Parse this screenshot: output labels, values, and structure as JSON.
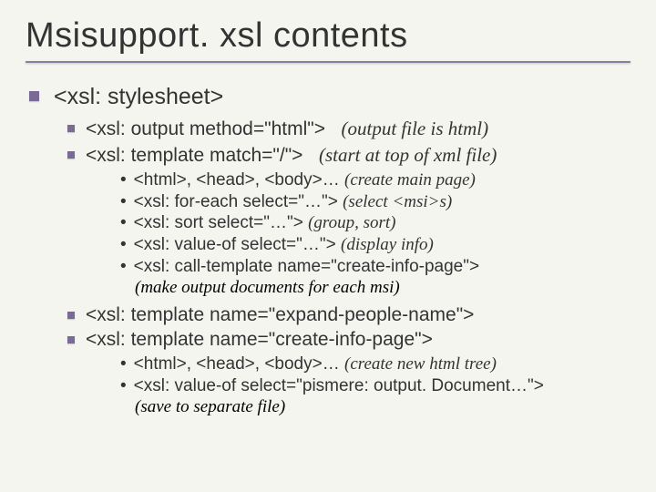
{
  "title": "Msisupport. xsl contents",
  "lvl1": {
    "text": "<xsl: stylesheet>"
  },
  "lvl2a": [
    {
      "code": "<xsl: output method=\"html\">",
      "note": "(output file is html)"
    },
    {
      "code": "<xsl: template match=\"/\">",
      "note": "(start at top of xml file)"
    }
  ],
  "lvl3a": [
    {
      "code": "<html>, <head>, <body>…",
      "note": "(create main page)"
    },
    {
      "code": "<xsl: for-each select=\"…\">",
      "note": "(select <msi>s)"
    },
    {
      "code": "<xsl: sort select=\"…\">",
      "note": "(group, sort)"
    },
    {
      "code": "<xsl: value-of select=\"…\">",
      "note": "(display info)"
    },
    {
      "code": "<xsl: call-template name=\"create-info-page\">",
      "note": ""
    }
  ],
  "lvl3a_trailnote": "(make output documents for each msi)",
  "lvl2b": [
    {
      "code": "<xsl: template name=\"expand-people-name\">",
      "note": ""
    },
    {
      "code": "<xsl: template name=\"create-info-page\">",
      "note": ""
    }
  ],
  "lvl3b": [
    {
      "code": "<html>, <head>, <body>…",
      "note": "(create new html tree)"
    },
    {
      "code": "<xsl: value-of select=\"pismere: output. Document…\">",
      "note": ""
    }
  ],
  "lvl3b_trailnote": "(save to separate file)"
}
